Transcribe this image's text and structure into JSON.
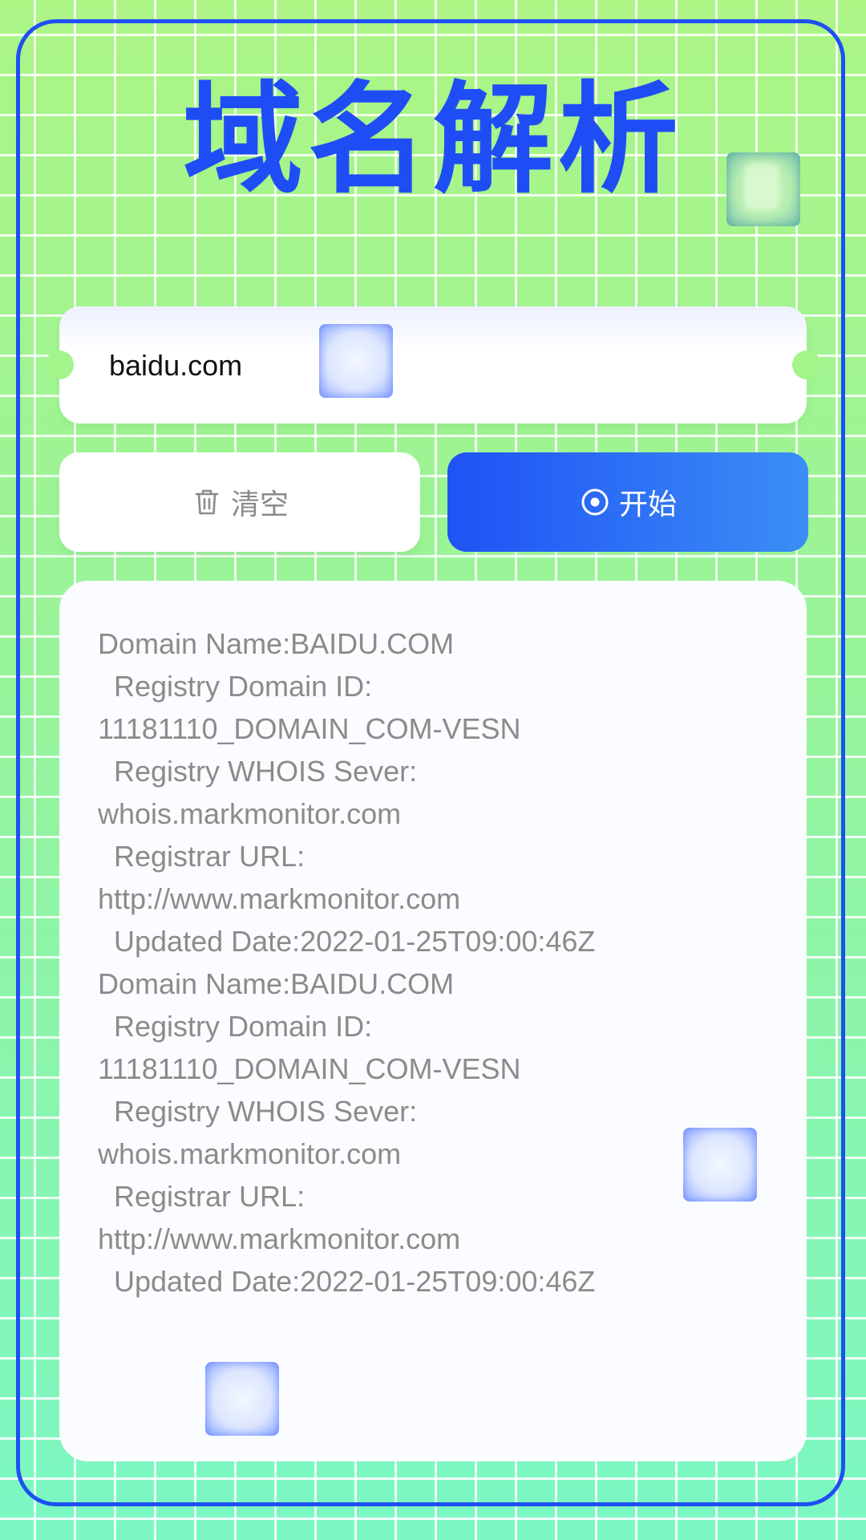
{
  "app": {
    "title": "域名解析"
  },
  "search": {
    "value": "baidu.com"
  },
  "actions": {
    "clear_label": "清空",
    "start_label": "开始"
  },
  "result": {
    "lines": [
      "Domain Name:BAIDU.COM",
      "  Registry Domain ID:",
      "11181110_DOMAIN_COM-VESN",
      "  Registry WHOIS Sever:",
      "whois.markmonitor.com",
      "  Registrar URL:",
      "http://www.markmonitor.com",
      "  Updated Date:2022-01-25T09:00:46Z",
      "Domain Name:BAIDU.COM",
      "  Registry Domain ID:",
      "11181110_DOMAIN_COM-VESN",
      "  Registry WHOIS Sever:",
      "whois.markmonitor.com",
      "  Registrar URL:",
      "http://www.markmonitor.com",
      "  Updated Date:2022-01-25T09:00:46Z"
    ]
  },
  "icons": {
    "clear": "trash-icon",
    "start": "target-icon"
  },
  "colors": {
    "primary": "#1f4df5",
    "start_gradient_end": "#3b8ef5",
    "background": "#a4f48c",
    "muted_text": "#8b8b8b"
  }
}
